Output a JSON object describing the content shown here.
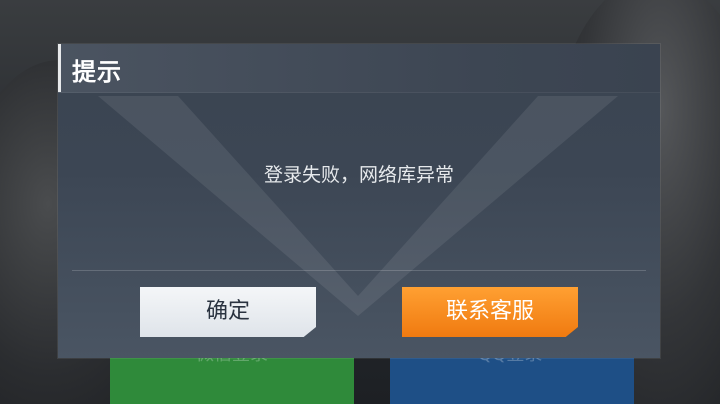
{
  "dialog": {
    "title": "提示",
    "message": "登录失败，网络库异常",
    "buttons": {
      "confirm_label": "确定",
      "support_label": "联系客服"
    }
  },
  "background": {
    "left_button_label": "微信登录",
    "right_button_label": "QQ登录"
  },
  "colors": {
    "confirm_button": "#e9edf1",
    "support_button": "#f7891f",
    "dialog_bg": "#3c4654"
  }
}
